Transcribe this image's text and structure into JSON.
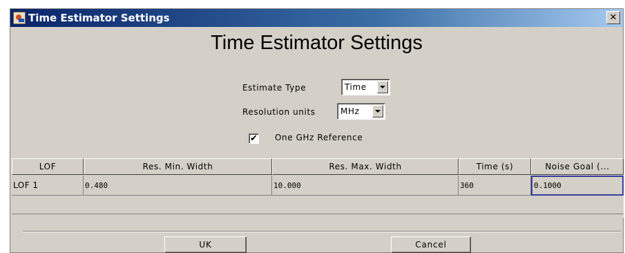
{
  "window": {
    "title": "Time Estimator Settings"
  },
  "heading": "Time Estimator Settings",
  "estimate_type": {
    "label": "Estimate Type",
    "value": "Time"
  },
  "resolution_units": {
    "label": "Resolution units",
    "value": "MHz"
  },
  "ghz_reference": {
    "label": "One GHz Reference",
    "checked": true,
    "mark": "✔"
  },
  "table": {
    "columns": [
      "LOF",
      "Res. Min. Width",
      "Res. Max. Width",
      "Time (s)",
      "Noise Goal (..."
    ],
    "rows": [
      [
        "LOF 1",
        "0.480",
        "10.000",
        "360",
        "0.1000"
      ]
    ]
  },
  "buttons": {
    "ok": "UK",
    "cancel": "Cancel"
  },
  "icons": {
    "app": "java-app-icon",
    "close": "close-icon"
  },
  "colors": {
    "titlebar_start": "#0a246a",
    "titlebar_end": "#a6caf0",
    "window_bg": "#d4d0c8",
    "selection_border": "#3a3aa0"
  }
}
